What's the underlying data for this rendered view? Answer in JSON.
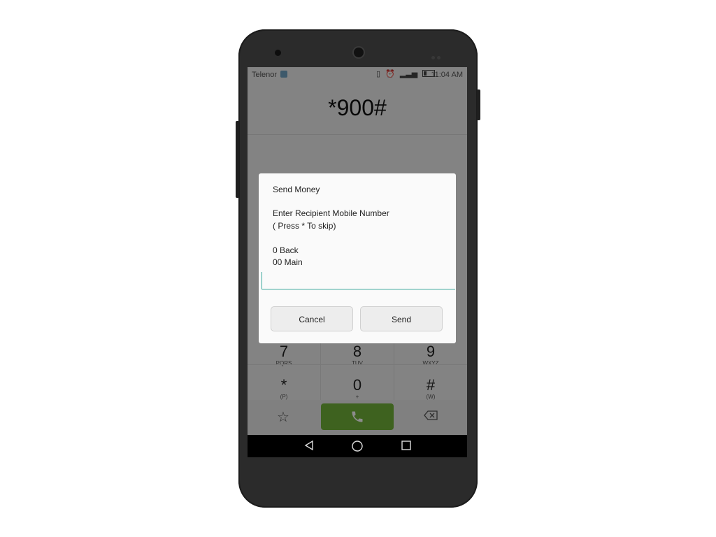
{
  "statusbar": {
    "carrier": "Telenor",
    "time": "11:04 AM"
  },
  "dialer": {
    "number": "*900#",
    "keys": [
      {
        "digit": "7",
        "letters": "PQRS"
      },
      {
        "digit": "8",
        "letters": "TUV"
      },
      {
        "digit": "9",
        "letters": "WXYZ"
      },
      {
        "digit": "*",
        "letters": "(P)"
      },
      {
        "digit": "0",
        "letters": "+"
      },
      {
        "digit": "#",
        "letters": "(W)"
      }
    ]
  },
  "dialog": {
    "title": "Send Money",
    "line1": "Enter Recipient Mobile Number",
    "line2": "( Press * To skip)",
    "option1": "0 Back",
    "option2": "00 Main",
    "input_value": "",
    "cancel_label": "Cancel",
    "send_label": "Send"
  },
  "colors": {
    "call_button": "#72b23a",
    "input_accent": "#3aa79c"
  },
  "icons": [
    "vibrate-icon",
    "alarm-icon",
    "signal-icon",
    "battery-icon",
    "favorite-star-icon",
    "phone-icon",
    "backspace-icon",
    "back-nav-icon",
    "home-nav-icon",
    "recents-nav-icon"
  ]
}
